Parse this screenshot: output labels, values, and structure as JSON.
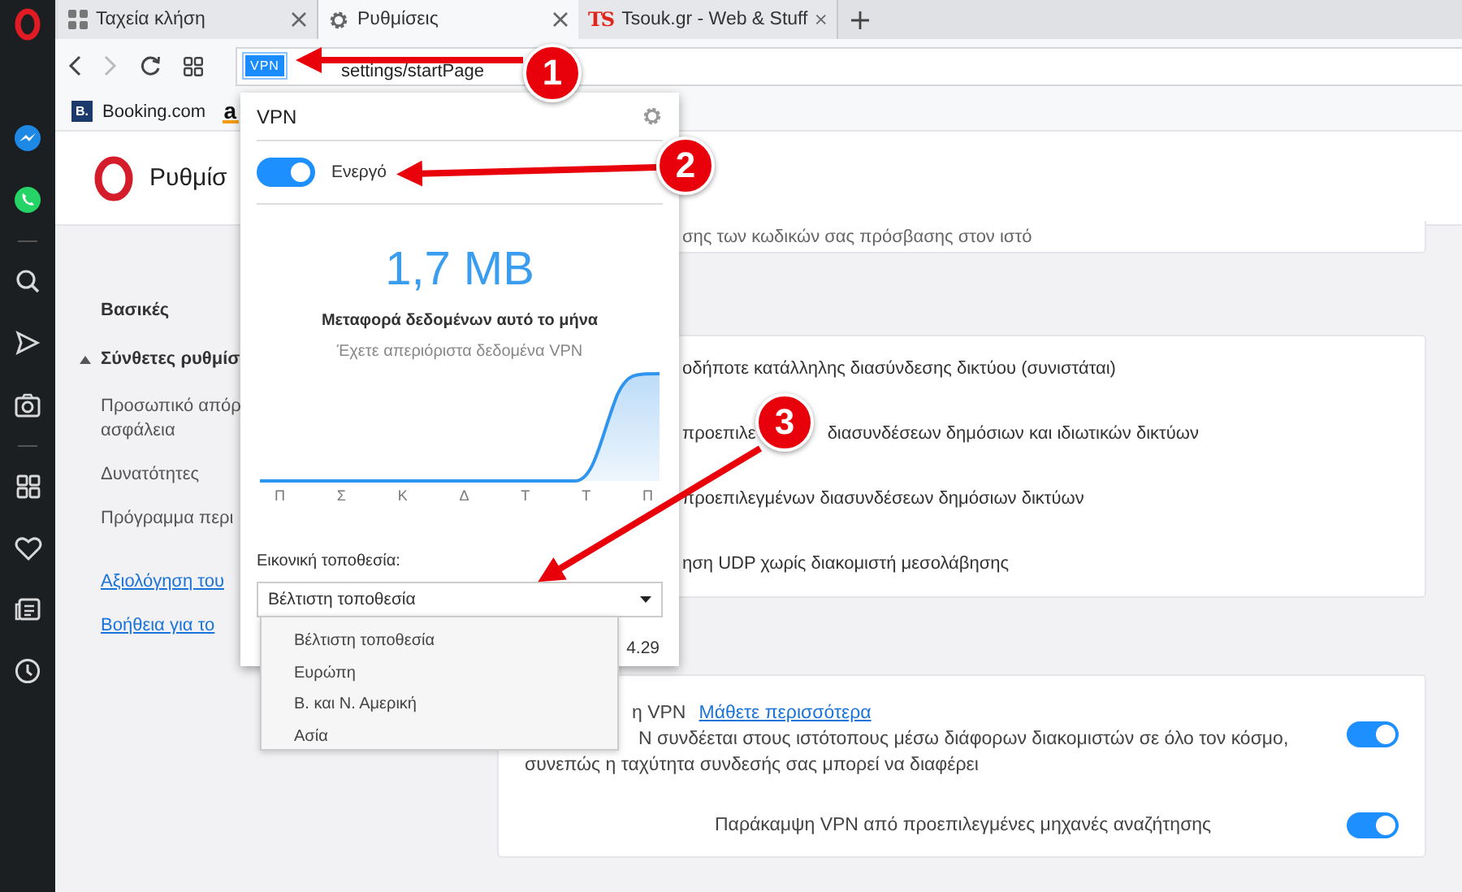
{
  "sidebar": {
    "items": [
      {
        "kind": "opera"
      },
      {
        "kind": "messenger"
      },
      {
        "kind": "whatsapp"
      },
      {
        "kind": "divider"
      },
      {
        "kind": "search"
      },
      {
        "kind": "send"
      },
      {
        "kind": "camera"
      },
      {
        "kind": "divider"
      },
      {
        "kind": "grid"
      },
      {
        "kind": "heart"
      },
      {
        "kind": "news"
      },
      {
        "kind": "history"
      }
    ]
  },
  "tabs": [
    {
      "label": "Ταχεία κλήση",
      "selected": false
    },
    {
      "label": "Ρυθμίσεις",
      "selected": true
    },
    {
      "label": "Tsouk.gr - Web & Stuff",
      "icon_text": "TS",
      "selected": false
    }
  ],
  "address_bar": {
    "badge": "VPN",
    "url": "settings/startPage"
  },
  "bookmarks": [
    {
      "icon_text": "B.",
      "label": "Booking.com"
    },
    {
      "icon_text": "a"
    }
  ],
  "settings": {
    "title": "Ρυθμίσ",
    "nav": [
      {
        "kind": "section",
        "lines": [
          "Βασικές"
        ]
      },
      {
        "kind": "section",
        "lines": [
          "Σύνθετες ρυθμίσ"
        ],
        "expanded": true
      },
      {
        "kind": "subitem",
        "lines": [
          "Προσωπικό απόρ",
          "ασφάλεια"
        ]
      },
      {
        "kind": "subitem",
        "lines": [
          "Δυνατότητες"
        ]
      },
      {
        "kind": "subitem",
        "lines": [
          "Πρόγραμμα περι"
        ]
      },
      {
        "kind": "link",
        "lines": [
          "Αξιολόγηση του"
        ]
      },
      {
        "kind": "link",
        "lines": [
          "Βοήθεια για το"
        ]
      }
    ],
    "cards": [
      {
        "rows": [
          {
            "kind": "text",
            "segments": [
              "σης των κωδικών σας πρόσβασης στον ιστό"
            ]
          }
        ]
      },
      {
        "rows": [
          {
            "kind": "text",
            "segments": [
              "οδήποτε κατάλληλης διασύνδεσης δικτύου (συνιστάται)"
            ]
          },
          {
            "kind": "text",
            "segments": [
              "προεπιλε",
              "διασυνδέσεων δημόσιων και ιδιωτικών δικτύων"
            ]
          },
          {
            "kind": "text",
            "segments": [
              "προεπιλεγμένων διασυνδέσεων δημόσιων δικτύων"
            ]
          },
          {
            "kind": "text",
            "segments": [
              "ηση UDP χωρίς διακομιστή μεσολάβησης"
            ]
          }
        ]
      },
      {
        "rows": [
          {
            "kind": "toggle",
            "title": "η VPN",
            "link": "Μάθετε περισσότερα",
            "description": [
              "N συνδέεται στους ιστότοπους μέσω διάφορων διακομιστών σε όλο τον κόσμο,",
              "συνεπώς η ταχύτητα συνδεσής σας μπορεί να διαφέρει"
            ],
            "on": true
          },
          {
            "kind": "toggle",
            "title": "Παράκαμψη VPN από προεπιλεγμένες μηχανές αναζήτησης",
            "on": true
          }
        ]
      }
    ]
  },
  "vpn_popup": {
    "title": "VPN",
    "enabled": true,
    "status": "Ενεργό",
    "usage": "1,7 MB",
    "usage_label": "Μεταφορά δεδομένων αυτό το μήνα",
    "note": "Έχετε απεριόριστα δεδομένα VPN",
    "days": [
      "Π",
      "Σ",
      "Κ",
      "Δ",
      "Τ",
      "Τ",
      "Π"
    ],
    "location_label": "Εικονική τοποθεσία:",
    "location": "Βέλτιστη τοποθεσία",
    "ip_fragment": "4.29",
    "options": [
      {
        "label": "Βέλτιστη τοποθεσία",
        "selected": false
      },
      {
        "label": "Ευρώπη",
        "selected": false
      },
      {
        "label": "Β. και Ν. Αμερική",
        "selected": false
      },
      {
        "label": "Ασία",
        "selected": false
      }
    ]
  },
  "annotations": [
    {
      "number": "1"
    },
    {
      "number": "2"
    },
    {
      "number": "3"
    }
  ]
}
